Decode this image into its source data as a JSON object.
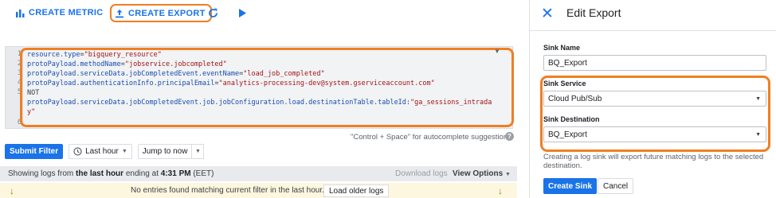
{
  "toolbar": {
    "create_metric": "CREATE METRIC",
    "create_export": "CREATE EXPORT",
    "refresh_icon": "refresh-icon",
    "run_icon": "play-icon"
  },
  "query": {
    "line_numbers": [
      "1",
      "2",
      "3",
      "4",
      "5",
      "",
      "6"
    ],
    "lines": [
      {
        "key": "resource.type",
        "op": "=",
        "val": "\"bigquery_resource\""
      },
      {
        "key": "protoPayload.methodName",
        "op": "=",
        "val": "\"jobservice.jobcompleted\""
      },
      {
        "key": "protoPayload.serviceData.jobCompletedEvent.eventName",
        "op": "=",
        "val": "\"load_job_completed\""
      },
      {
        "key": "protoPayload.authenticationInfo.principalEmail",
        "op": "=",
        "val": "\"analytics-processing-dev@system.gserviceaccount.com\""
      },
      {
        "key": "NOT",
        "op": "",
        "val": ""
      },
      {
        "key": "protoPayload.serviceData.jobCompletedEvent.job.jobConfiguration.load.destinationTable.tableId",
        "op": ":",
        "val": "\"ga_sessions_intrada"
      },
      {
        "key": "",
        "op": "",
        "val": "y\""
      }
    ],
    "hint": "\"Control + Space\" for autocomplete suggestions"
  },
  "controls": {
    "submit": "Submit Filter",
    "time_range": "Last hour",
    "jump": "Jump to now"
  },
  "status": {
    "prefix": "Showing logs from ",
    "range": "the last hour",
    "middle": " ending at ",
    "time": "4:31 PM",
    "suffix": " (EET)",
    "download": "Download logs",
    "view_options": "View Options"
  },
  "empty": {
    "message": "No entries found matching current filter in the last hour.",
    "load_older": "Load older logs"
  },
  "panel": {
    "title": "Edit Export",
    "sink_name_label": "Sink Name",
    "sink_name_value": "BQ_Export",
    "sink_service_label": "Sink Service",
    "sink_service_value": "Cloud Pub/Sub",
    "sink_destination_label": "Sink Destination",
    "sink_destination_value": "BQ_Export",
    "description": "Creating a log sink will export future matching logs to the selected destination.",
    "create_sink": "Create Sink",
    "cancel": "Cancel"
  },
  "colors": {
    "accent": "#1a73e8",
    "highlight": "#f07f23"
  }
}
